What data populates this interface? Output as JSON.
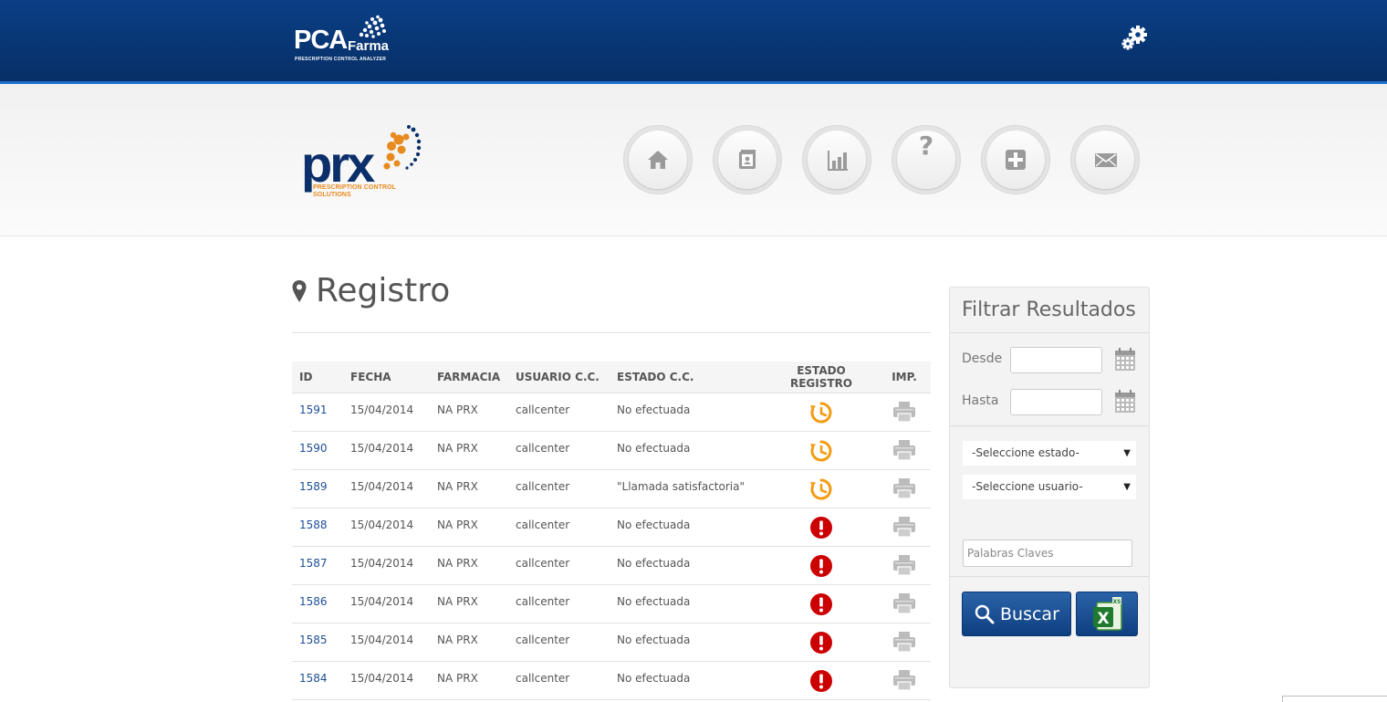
{
  "topbar": {
    "logo_main": "PCA",
    "logo_farma": "Farma",
    "logo_sub": "PRESCRIPTION CONTROL ANALYZER"
  },
  "brand": {
    "word": "prx",
    "tag_line1": "PRESCRIPTION CONTROL",
    "tag_line2": "SOLUTIONS"
  },
  "nav": [
    {
      "icon": "home-icon"
    },
    {
      "icon": "contacts-icon"
    },
    {
      "icon": "chart-icon"
    },
    {
      "icon": "help-icon"
    },
    {
      "icon": "plus-icon"
    },
    {
      "icon": "mail-icon"
    }
  ],
  "page": {
    "title": "Registro"
  },
  "table": {
    "headers": {
      "id": "ID",
      "fecha": "FECHA",
      "farmacia": "FARMACIA",
      "usuario": "USUARIO C.C.",
      "estado_cc": "ESTADO C.C.",
      "estado_reg": "ESTADO REGISTRO",
      "imp": "IMP."
    },
    "rows": [
      {
        "id": "1591",
        "fecha": "15/04/2014",
        "farmacia": "NA PRX",
        "usuario": "callcenter",
        "estado_cc": "No efectuada",
        "status": "pending"
      },
      {
        "id": "1590",
        "fecha": "15/04/2014",
        "farmacia": "NA PRX",
        "usuario": "callcenter",
        "estado_cc": "No efectuada",
        "status": "pending"
      },
      {
        "id": "1589",
        "fecha": "15/04/2014",
        "farmacia": "NA PRX",
        "usuario": "callcenter",
        "estado_cc": "\"Llamada satisfactoria\"",
        "status": "pending"
      },
      {
        "id": "1588",
        "fecha": "15/04/2014",
        "farmacia": "NA PRX",
        "usuario": "callcenter",
        "estado_cc": "No efectuada",
        "status": "alert"
      },
      {
        "id": "1587",
        "fecha": "15/04/2014",
        "farmacia": "NA PRX",
        "usuario": "callcenter",
        "estado_cc": "No efectuada",
        "status": "alert"
      },
      {
        "id": "1586",
        "fecha": "15/04/2014",
        "farmacia": "NA PRX",
        "usuario": "callcenter",
        "estado_cc": "No efectuada",
        "status": "alert"
      },
      {
        "id": "1585",
        "fecha": "15/04/2014",
        "farmacia": "NA PRX",
        "usuario": "callcenter",
        "estado_cc": "No efectuada",
        "status": "alert"
      },
      {
        "id": "1584",
        "fecha": "15/04/2014",
        "farmacia": "NA PRX",
        "usuario": "callcenter",
        "estado_cc": "No efectuada",
        "status": "alert"
      }
    ]
  },
  "filter": {
    "title": "Filtrar Resultados",
    "desde_label": "Desde",
    "hasta_label": "Hasta",
    "desde_value": "",
    "hasta_value": "",
    "estado_select": "-Seleccione estado-",
    "usuario_select": "-Seleccione usuario-",
    "keywords_placeholder": "Palabras Claves",
    "buscar_label": "Buscar"
  },
  "colors": {
    "topbar": "#0a3f86",
    "link": "#1d4e95",
    "pending": "#f39c12",
    "alert": "#cc0000",
    "button": "#0d3f80"
  }
}
